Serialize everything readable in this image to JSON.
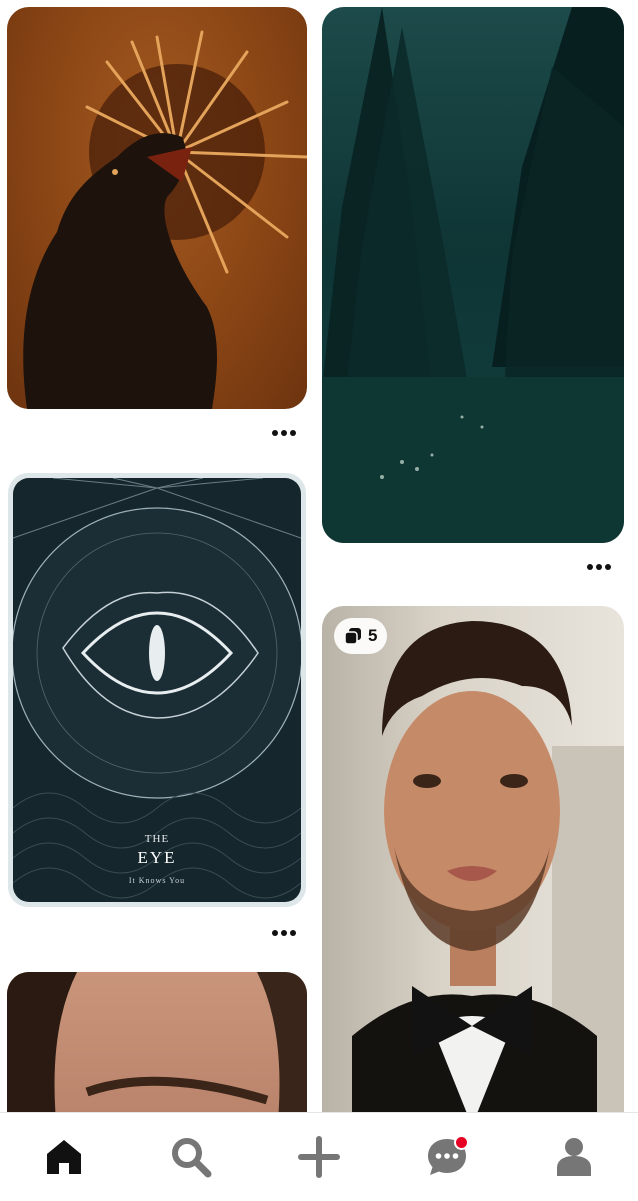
{
  "feed": {
    "pins": [
      {
        "id": "wolf",
        "description": "",
        "has_more": true
      },
      {
        "id": "forest",
        "description": "",
        "has_more": true
      },
      {
        "id": "eye",
        "card_title_small": "THE",
        "card_title": "EYE",
        "card_subtitle": "It Knows You",
        "has_more": true
      },
      {
        "id": "man",
        "board_count": "5"
      },
      {
        "id": "face"
      }
    ]
  },
  "tabbar": {
    "items": [
      {
        "name": "home",
        "icon": "home-icon",
        "active": true
      },
      {
        "name": "search",
        "icon": "search-icon"
      },
      {
        "name": "create",
        "icon": "plus-icon"
      },
      {
        "name": "messages",
        "icon": "chat-icon",
        "has_notification": true
      },
      {
        "name": "profile",
        "icon": "profile-icon"
      }
    ]
  },
  "colors": {
    "icon_active": "#111111",
    "icon_inactive": "#767676",
    "notification": "#e60023"
  }
}
